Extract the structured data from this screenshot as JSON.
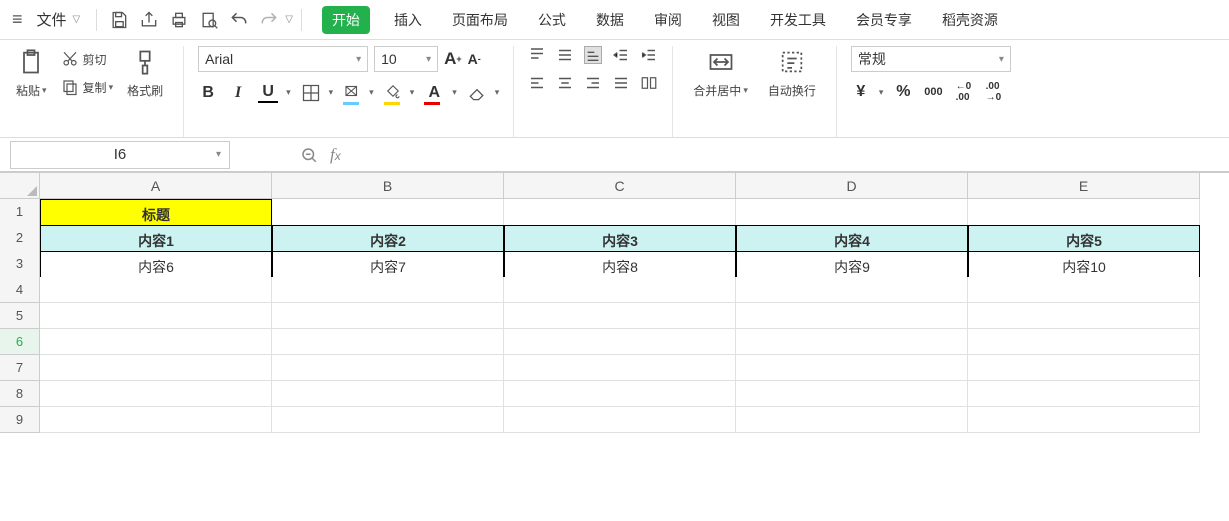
{
  "topbar": {
    "file_label": "文件",
    "qat": [
      "save",
      "share",
      "print",
      "preview",
      "undo",
      "redo"
    ]
  },
  "tabs": {
    "active": "开始",
    "items": [
      "插入",
      "页面布局",
      "公式",
      "数据",
      "审阅",
      "视图",
      "开发工具",
      "会员专享",
      "稻壳资源"
    ]
  },
  "clipboard": {
    "paste": "粘贴",
    "cut": "剪切",
    "copy": "复制",
    "format_painter": "格式刷"
  },
  "font": {
    "name": "Arial",
    "size": "10"
  },
  "merge": {
    "label": "合并居中"
  },
  "wrap": {
    "label": "自动换行"
  },
  "number_format": {
    "value": "常规"
  },
  "namebox": {
    "ref": "I6"
  },
  "sheet": {
    "columns": [
      "A",
      "B",
      "C",
      "D",
      "E"
    ],
    "rows": [
      "1",
      "2",
      "3",
      "4",
      "5",
      "6",
      "7",
      "8",
      "9"
    ],
    "selected_row": "6",
    "title": "标题",
    "header_row": [
      "内容1",
      "内容2",
      "内容3",
      "内容4",
      "内容5"
    ],
    "data_row": [
      "内容6",
      "内容7",
      "内容8",
      "内容9",
      "内容10"
    ]
  },
  "colors": {
    "title_bg": "#ffff00",
    "header_bg": "#ccf2f2",
    "accent": "#22b14c"
  }
}
